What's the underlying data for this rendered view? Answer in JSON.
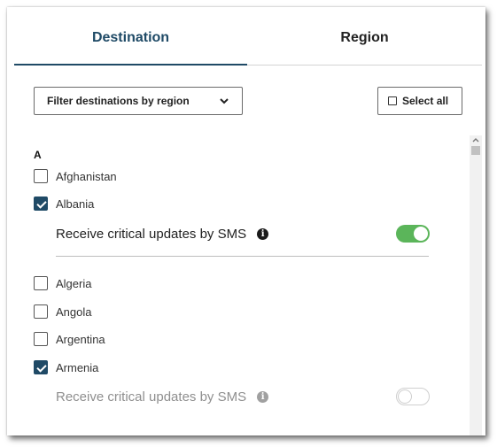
{
  "tabs": [
    {
      "label": "Destination",
      "active": true
    },
    {
      "label": "Region",
      "active": false
    }
  ],
  "filter": {
    "label": "Filter destinations by region",
    "icon": "chevron-down-icon"
  },
  "select_all": {
    "label": "Select all",
    "checked": false
  },
  "list": {
    "section_letter": "A",
    "countries": [
      {
        "name": "Afghanistan",
        "checked": false
      },
      {
        "name": "Albania",
        "checked": true
      },
      {
        "name": "Algeria",
        "checked": false
      },
      {
        "name": "Angola",
        "checked": false
      },
      {
        "name": "Argentina",
        "checked": false
      },
      {
        "name": "Armenia",
        "checked": true
      }
    ],
    "sms_options": [
      {
        "country": "Albania",
        "label": "Receive critical updates by SMS",
        "enabled": true
      },
      {
        "country": "Armenia",
        "label": "Receive critical updates by SMS",
        "enabled": false
      }
    ]
  },
  "colors": {
    "accent": "#1f4a66",
    "toggle_on": "#5bb55a"
  }
}
